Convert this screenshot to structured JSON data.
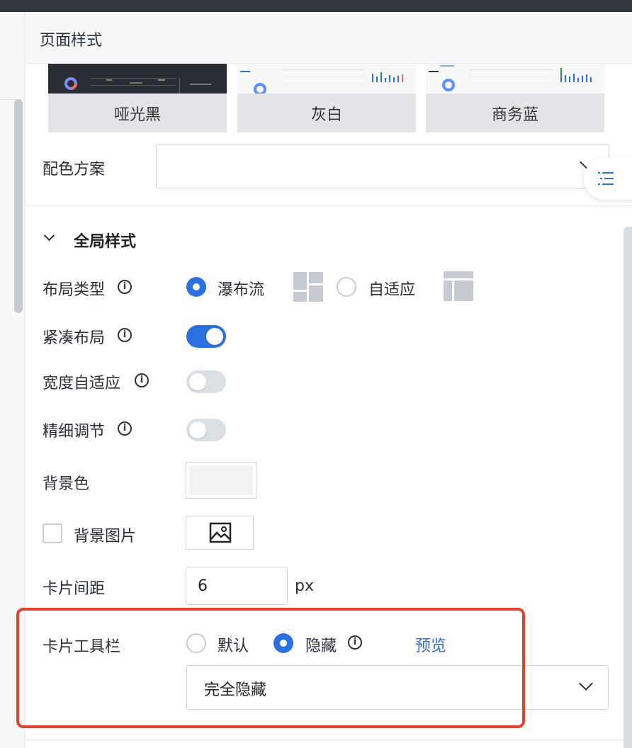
{
  "panel": {
    "title": "页面样式"
  },
  "themes": [
    {
      "name": "哑光黑"
    },
    {
      "name": "灰白"
    },
    {
      "name": "商务蓝"
    }
  ],
  "color_scheme": {
    "label": "配色方案",
    "value": ""
  },
  "global_style": {
    "title": "全局样式",
    "layout_type": {
      "label": "布局类型",
      "options": [
        "瀑布流",
        "自适应"
      ],
      "selected": "瀑布流"
    },
    "compact_layout": {
      "label": "紧凑布局",
      "on": true
    },
    "width_adaptive": {
      "label": "宽度自适应",
      "on": false
    },
    "fine_tune": {
      "label": "精细调节",
      "on": false
    },
    "background_color": {
      "label": "背景色",
      "color": "#f2f3f5"
    },
    "background_image": {
      "label": "背景图片",
      "checked": false
    },
    "card_spacing": {
      "label": "卡片间距",
      "value": "6",
      "unit": "px"
    },
    "card_toolbar": {
      "label": "卡片工具栏",
      "options": [
        "默认",
        "隐藏"
      ],
      "selected": "隐藏",
      "preview_link": "预览",
      "hide_mode": "完全隐藏"
    }
  },
  "colors": {
    "accent": "#2c6fde",
    "highlight_border": "#e2432f"
  },
  "icons": [
    "info-icon",
    "chevron-down-icon",
    "image-icon",
    "list-icon",
    "waterfall-layout-icon",
    "adaptive-layout-icon"
  ]
}
